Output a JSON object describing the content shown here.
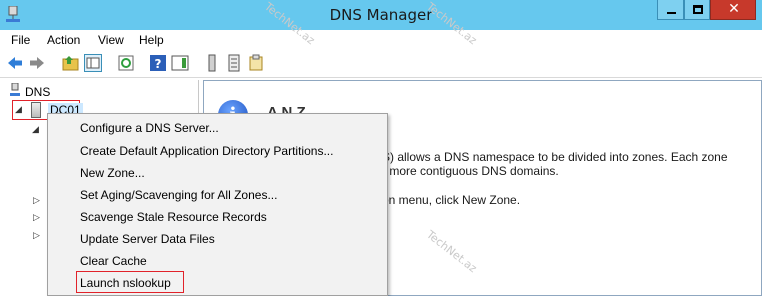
{
  "window": {
    "title": "DNS Manager",
    "close_glyph": "✕"
  },
  "menubar": [
    "File",
    "Action",
    "View",
    "Help"
  ],
  "toolbar": {
    "icons": [
      "back-icon",
      "forward-icon",
      "up-folder-icon",
      "show-hide-tree-icon",
      "refresh-icon",
      "help-icon",
      "action-pane-icon",
      "server-icon",
      "list-icon",
      "properties-icon"
    ]
  },
  "tree": {
    "root_label": "DNS",
    "selected_label": "DC01"
  },
  "main": {
    "info_glyph": "i",
    "title_fragment": "A N  Z",
    "lines": [
      "S) allows a DNS namespace to be divided into zones. Each zone",
      "r more contiguous DNS domains.",
      "on menu, click New Zone."
    ]
  },
  "context_menu": {
    "items": [
      "Configure a DNS Server...",
      "Create Default Application Directory Partitions...",
      "New Zone...",
      "Set Aging/Scavenging for All Zones...",
      "Scavenge Stale Resource Records",
      "Update Server Data Files",
      "Clear Cache",
      "Launch nslookup"
    ],
    "highlighted_item": "Launch nslookup"
  },
  "watermark": "TechNet.az",
  "colors": {
    "titlebar": "#66c8ee",
    "close_button": "#c7392b",
    "highlight_border": "#e1222a",
    "selection_fill": "#cce8ff"
  }
}
